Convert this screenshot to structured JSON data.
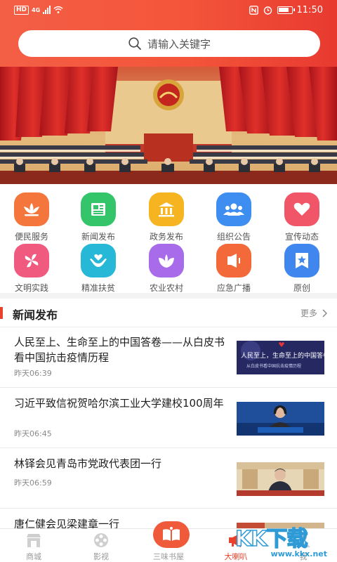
{
  "status_bar": {
    "network_badge": "HD",
    "network_type": "4G",
    "time": "11:50"
  },
  "search": {
    "placeholder": "请输入关键字"
  },
  "grid": [
    {
      "label": "便民服务",
      "icon": "lotus-icon",
      "color": "#f4763c"
    },
    {
      "label": "新闻发布",
      "icon": "newspaper-icon",
      "color": "#34c56a"
    },
    {
      "label": "政务发布",
      "icon": "government-icon",
      "color": "#f6b520"
    },
    {
      "label": "组织公告",
      "icon": "people-icon",
      "color": "#3d8ef0"
    },
    {
      "label": "宣传动态",
      "icon": "heart-icon",
      "color": "#f05568"
    },
    {
      "label": "文明实践",
      "icon": "pinwheel-icon",
      "color": "#f05a7e"
    },
    {
      "label": "精准扶贫",
      "icon": "helping-hands-icon",
      "color": "#27b8d8"
    },
    {
      "label": "农业农村",
      "icon": "leaf-icon",
      "color": "#a86bea"
    },
    {
      "label": "应急广播",
      "icon": "speaker-icon",
      "color": "#f4693a"
    },
    {
      "label": "原创",
      "icon": "star-badge-icon",
      "color": "#3f87ee"
    }
  ],
  "news_section": {
    "title": "新闻发布",
    "more": "更多"
  },
  "news": [
    {
      "title": "人民至上、生命至上的中国答卷——从白皮书看中国抗击疫情历程",
      "time": "昨天06:39",
      "thumb_text": "人民至上，生命至上的中国答卷",
      "thumb_sub": "从白皮书看中国抗击疫情历程"
    },
    {
      "title": "习近平致信祝贺哈尔滨工业大学建校100周年",
      "time": "昨天06:45"
    },
    {
      "title": "林铎会见青岛市党政代表团一行",
      "time": "昨天06:59"
    },
    {
      "title": "唐仁健会见梁建章一行",
      "time": ""
    }
  ],
  "tabs": [
    {
      "label": "商城",
      "icon": "shop-icon",
      "active": false
    },
    {
      "label": "影视",
      "icon": "film-icon",
      "active": false
    },
    {
      "label": "三味书屋",
      "icon": "book-icon",
      "active": false
    },
    {
      "label": "大喇叭",
      "icon": "megaphone-icon",
      "active": true
    },
    {
      "label": "我",
      "icon": "user-icon",
      "active": false
    }
  ],
  "watermark": {
    "big": "KK下载",
    "small": "www.kkx.net"
  },
  "colors": {
    "accent": "#e8412c",
    "header": "#f35f45"
  }
}
